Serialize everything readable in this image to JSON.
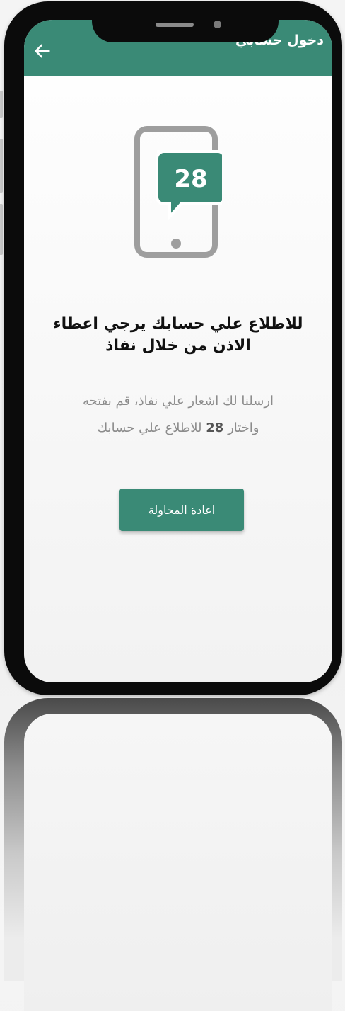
{
  "appbar": {
    "title": "دخول حسابي"
  },
  "icons": {
    "back": "arrow-left-icon",
    "illustration": "phone-message-icon"
  },
  "illustration": {
    "code": "28"
  },
  "content": {
    "headline_line1": "للاطلاع علي حسابك يرجي اعطاء",
    "headline_line2": "الاذن من خلال نفاذ",
    "description_line1": "ارسلنا لك اشعار علي نفاذ، قم بفتحه",
    "description_line2_prefix": "واختار",
    "description_code": "28",
    "description_line2_suffix": "للاطلاع علي حسابك"
  },
  "actions": {
    "retry_label": "اعادة المحاولة"
  },
  "colors": {
    "accent": "#3a8a76",
    "illustration_gray": "#9e9e9e",
    "bubble_green": "#3a8a76"
  }
}
